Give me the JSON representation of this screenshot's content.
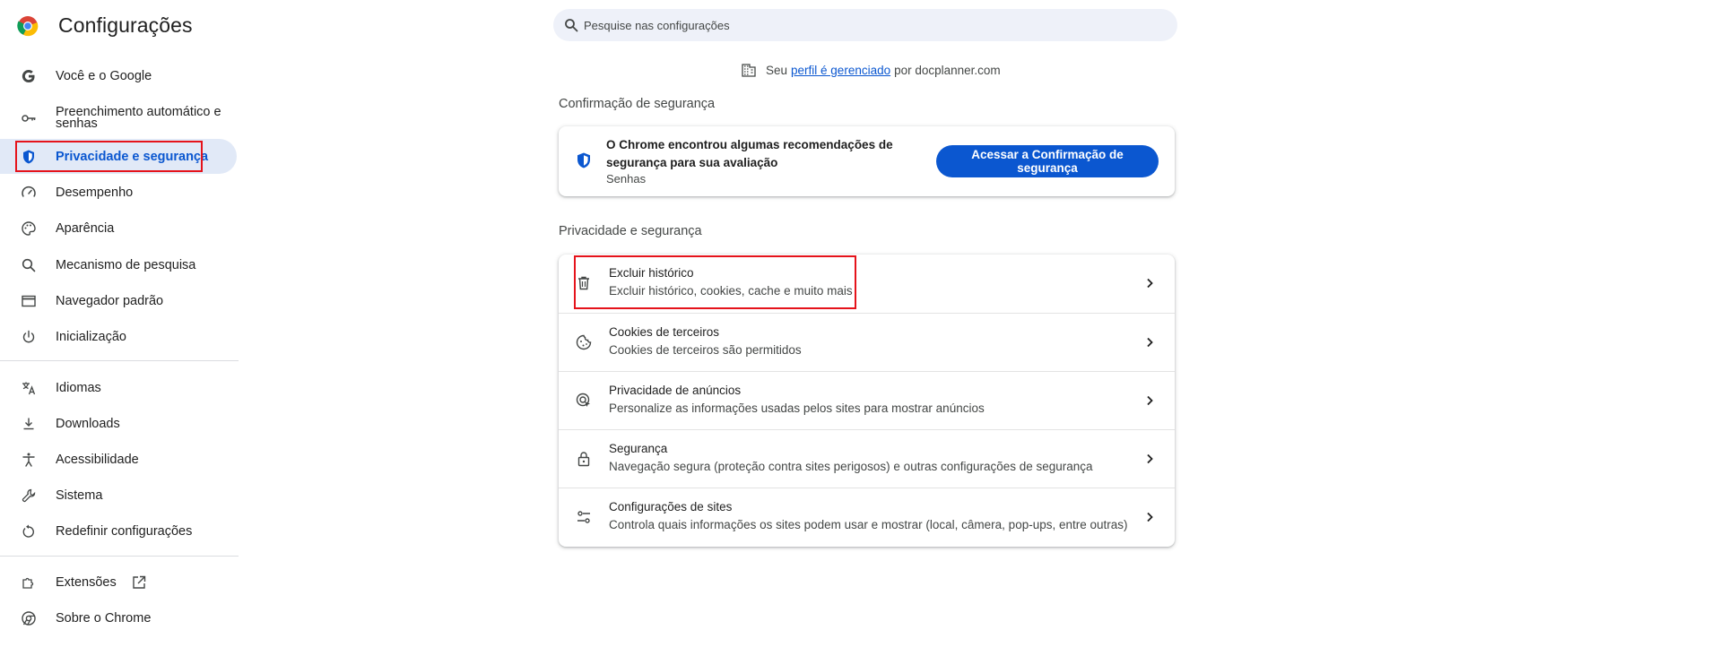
{
  "app": {
    "title": "Configurações"
  },
  "search": {
    "placeholder": "Pesquise nas configurações"
  },
  "colors": {
    "accent": "#0b57d0",
    "active_bg": "#e1e9f7",
    "highlight_box": "#e5131b"
  },
  "sidebar": {
    "items": [
      {
        "label": "Você e o Google",
        "icon": "google-icon"
      },
      {
        "label": "Preenchimento automático e senhas",
        "icon": "key-icon"
      },
      {
        "label": "Privacidade e segurança",
        "icon": "shield-icon",
        "active": true
      },
      {
        "label": "Desempenho",
        "icon": "speedometer-icon"
      },
      {
        "label": "Aparência",
        "icon": "palette-icon"
      },
      {
        "label": "Mecanismo de pesquisa",
        "icon": "search-icon"
      },
      {
        "label": "Navegador padrão",
        "icon": "browser-window-icon"
      },
      {
        "label": "Inicialização",
        "icon": "power-icon"
      },
      {
        "label": "Idiomas",
        "icon": "translate-icon"
      },
      {
        "label": "Downloads",
        "icon": "download-icon"
      },
      {
        "label": "Acessibilidade",
        "icon": "accessibility-icon"
      },
      {
        "label": "Sistema",
        "icon": "wrench-icon"
      },
      {
        "label": "Redefinir configurações",
        "icon": "reset-icon"
      },
      {
        "label": "Extensões",
        "icon": "puzzle-icon"
      },
      {
        "label": "Sobre o Chrome",
        "icon": "chrome-icon"
      }
    ]
  },
  "managed": {
    "prefix": "Seu",
    "link": "perfil é gerenciado",
    "suffix": "por docplanner.com"
  },
  "safety_check": {
    "section_title": "Confirmação de segurança",
    "message": "O Chrome encontrou algumas recomendações de segurança para sua avaliação",
    "sub": "Senhas",
    "button": "Acessar a Confirmação de segurança"
  },
  "privacy": {
    "section_title": "Privacidade e segurança",
    "rows": [
      {
        "title": "Excluir histórico",
        "sub": "Excluir histórico, cookies, cache e muito mais",
        "icon": "trash-icon"
      },
      {
        "title": "Cookies de terceiros",
        "sub": "Cookies de terceiros são permitidos",
        "icon": "cookie-icon"
      },
      {
        "title": "Privacidade de anúncios",
        "sub": "Personalize as informações usadas pelos sites para mostrar anúncios",
        "icon": "ad-privacy-icon"
      },
      {
        "title": "Segurança",
        "sub": "Navegação segura (proteção contra sites perigosos) e outras configurações de segurança",
        "icon": "lock-icon"
      },
      {
        "title": "Configurações de sites",
        "sub": "Controla quais informações os sites podem usar e mostrar (local, câmera, pop-ups, entre outras)",
        "icon": "sliders-icon"
      }
    ]
  }
}
